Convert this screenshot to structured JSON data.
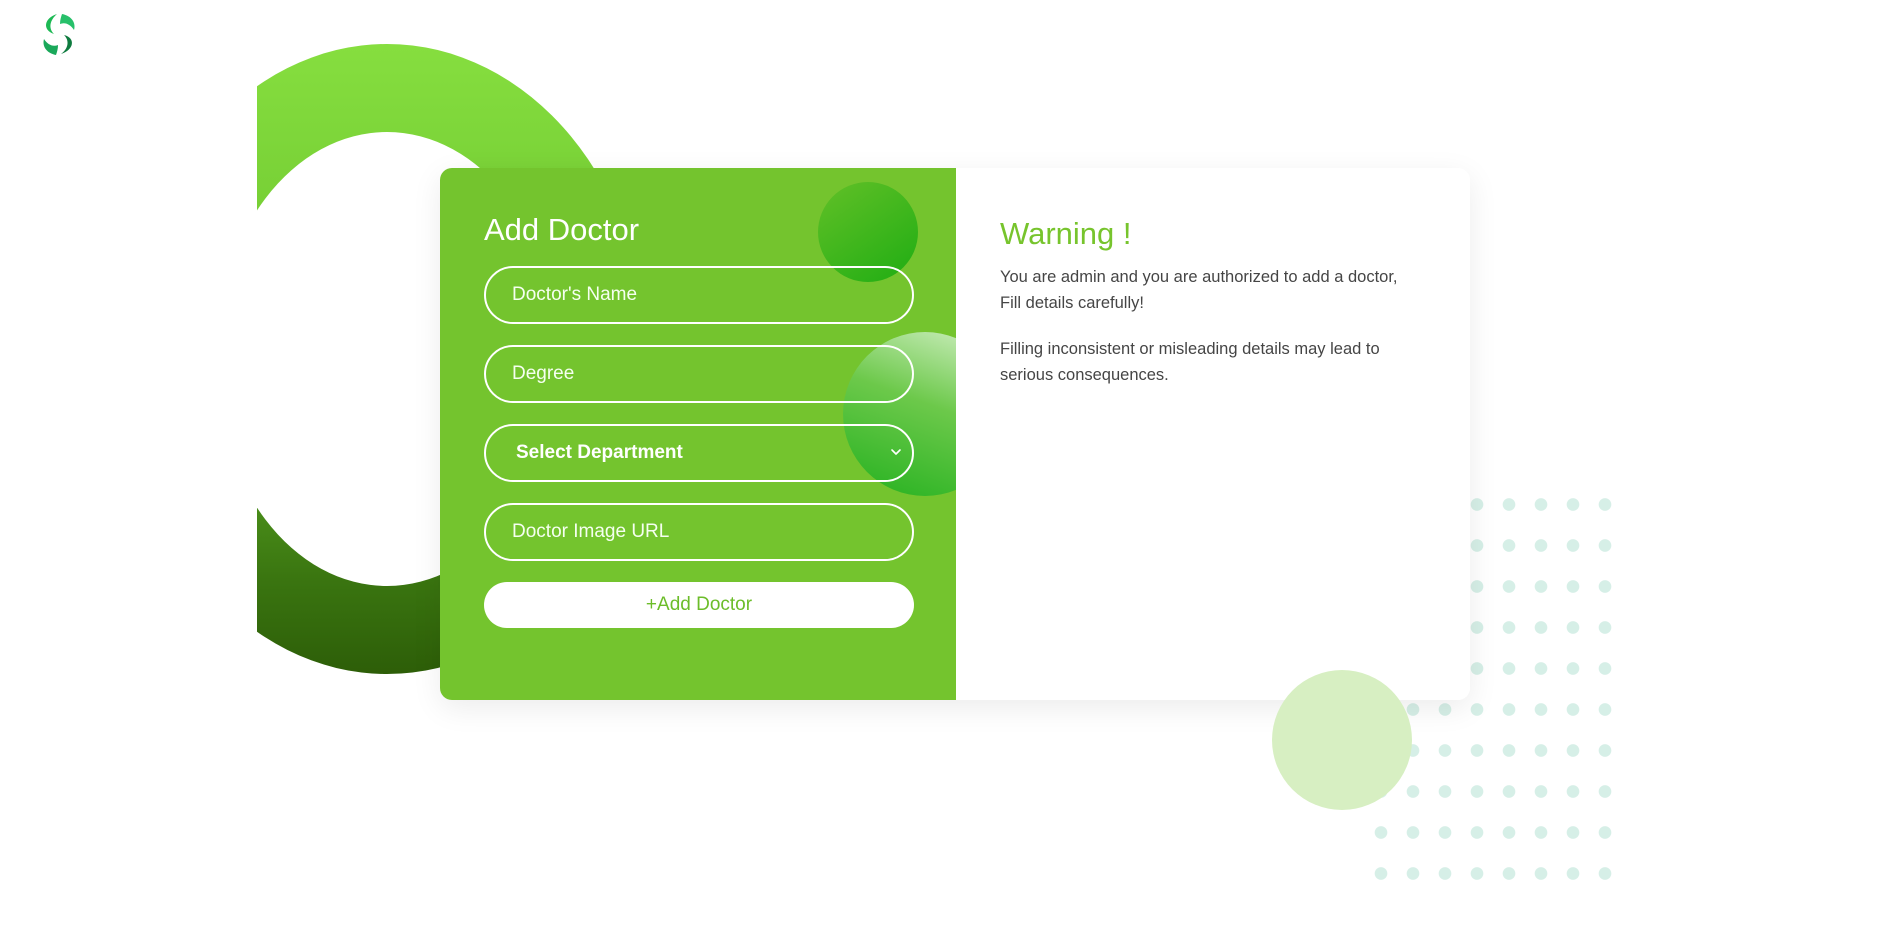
{
  "app": {
    "logo_icon": "leaf-s-logo-icon"
  },
  "form": {
    "title": "Add Doctor",
    "name_placeholder": "Doctor's Name",
    "degree_placeholder": "Degree",
    "department_selected": "Select Department",
    "image_url_placeholder": "Doctor Image URL",
    "submit_label": "+Add Doctor"
  },
  "warning": {
    "title": "Warning !",
    "line1": "You are admin and you are authorized to add a doctor, Fill details carefully!",
    "line2": "Filling inconsistent or misleading details may lead to serious consequences."
  },
  "colors": {
    "accent": "#74c42e",
    "text": "#454545"
  }
}
